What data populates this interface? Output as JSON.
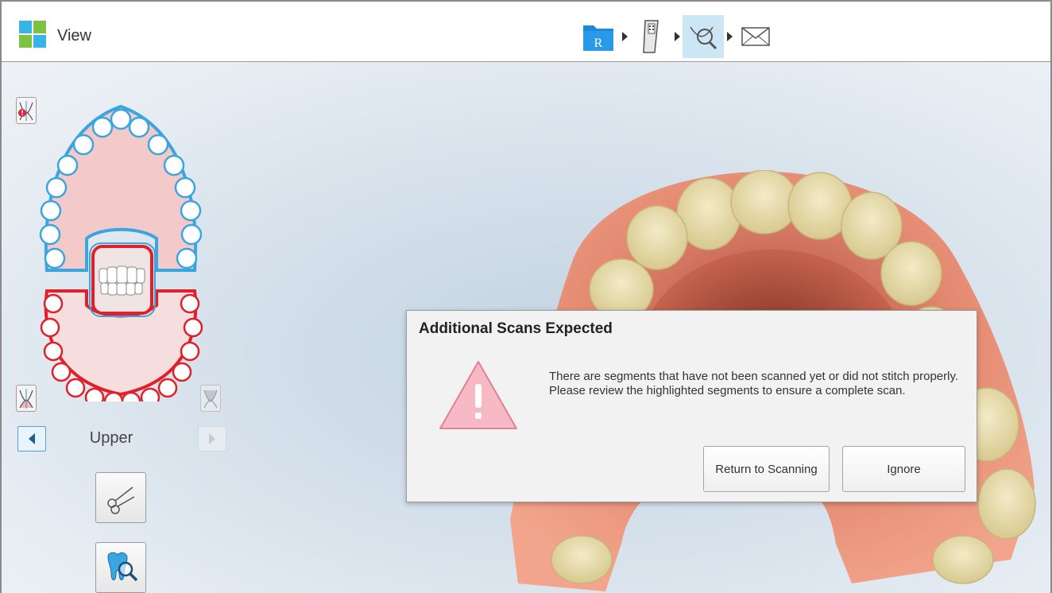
{
  "header": {
    "title": "View",
    "workflow_steps": [
      {
        "icon": "rx-folder-icon",
        "active": false
      },
      {
        "icon": "scanner-icon",
        "active": false
      },
      {
        "icon": "view-scan-icon",
        "active": true
      },
      {
        "icon": "envelope-icon",
        "active": false
      }
    ],
    "workflow_step_rx_letter": "R"
  },
  "left_panel": {
    "jaw_label": "Upper",
    "jaw_colors": {
      "upper": "#3aa6e0",
      "lower": "#e0202a"
    }
  },
  "dialog": {
    "title": "Additional Scans Expected",
    "message_line1": "There are segments that have not been scanned yet or did not stitch properly.",
    "message_line2": "Please review the highlighted segments to ensure a complete scan.",
    "return_button": "Return to Scanning",
    "ignore_button": "Ignore"
  }
}
